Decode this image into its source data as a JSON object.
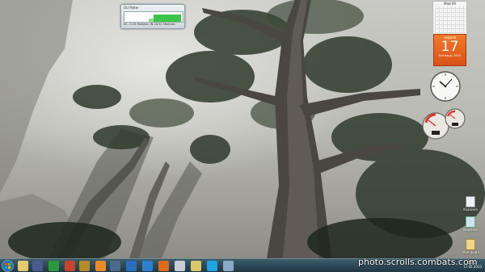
{
  "gadgets": {
    "netmeter": {
      "title": "DU Meter",
      "stats": "IN - 0.53 Mbit/sec    IN 18.51 Mbit/sec"
    },
    "calendar": {
      "mini_header": "Май 09",
      "month": "неделя",
      "day": "17",
      "weekday": "Пятница, 2013"
    },
    "clock": {
      "time": "10:10"
    }
  },
  "desktop_icons": [
    {
      "label": "Корзина"
    },
    {
      "label": "Корзина"
    },
    {
      "label": "Мой файл"
    }
  ],
  "taskbar": {
    "tray_time": "12:15",
    "tray_date": "17.05.2013"
  },
  "watermark": "photo.scrolls.combats.com",
  "colors": {
    "taskbar": "#2a4753",
    "calendar_accent": "#e8641f",
    "net_graph": "#3cc44a"
  }
}
